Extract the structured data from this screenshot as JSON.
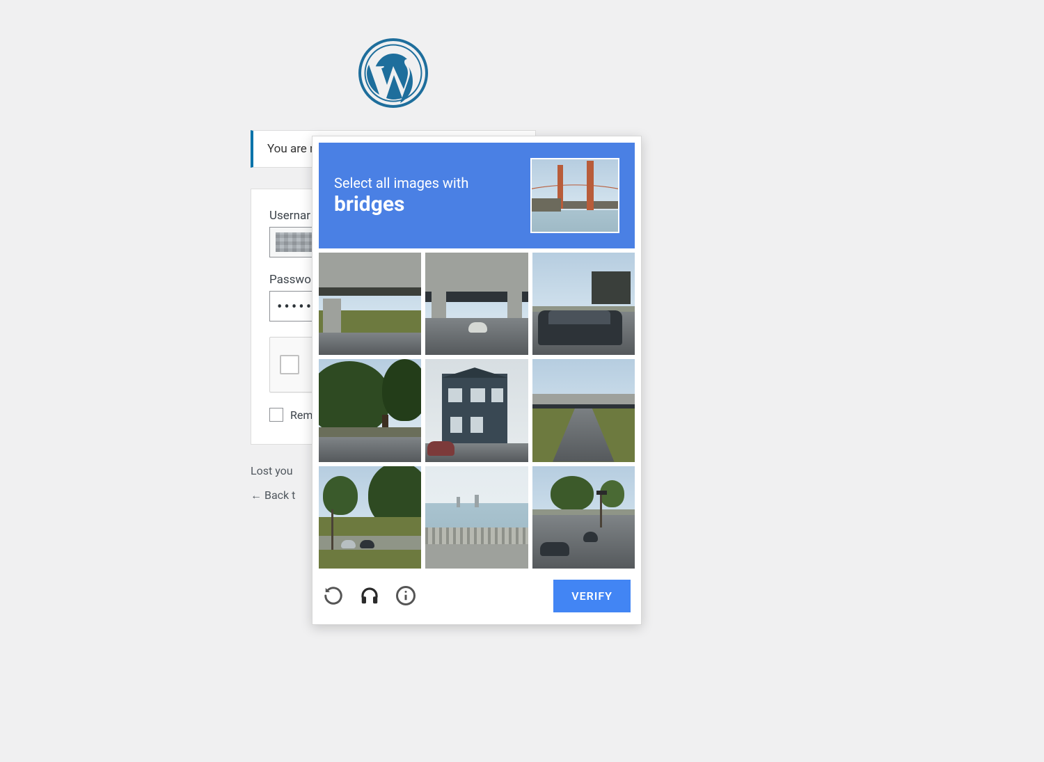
{
  "login": {
    "notice_text": "You are n",
    "username_label": "Usernar",
    "username_value": "",
    "password_label": "Passwor",
    "password_value": "•••••",
    "remember_label": "Reme",
    "lost_password_text": "Lost you",
    "back_text": "Back t"
  },
  "captcha": {
    "header_line1": "Select all images with",
    "header_keyword": "bridges",
    "verify_label": "VERIFY",
    "tiles": [
      {
        "id": 1,
        "desc": "highway overpass"
      },
      {
        "id": 2,
        "desc": "under freeway bridge"
      },
      {
        "id": 3,
        "desc": "parked car by bus stop"
      },
      {
        "id": 4,
        "desc": "trees street view"
      },
      {
        "id": 5,
        "desc": "dark two-story house"
      },
      {
        "id": 6,
        "desc": "road under overpass"
      },
      {
        "id": 7,
        "desc": "hillside parking lot"
      },
      {
        "id": 8,
        "desc": "waterfront with railing"
      },
      {
        "id": 9,
        "desc": "suburban intersection"
      }
    ],
    "icons": {
      "reload": "reload-icon",
      "audio": "headphones-icon",
      "info": "info-icon"
    }
  }
}
